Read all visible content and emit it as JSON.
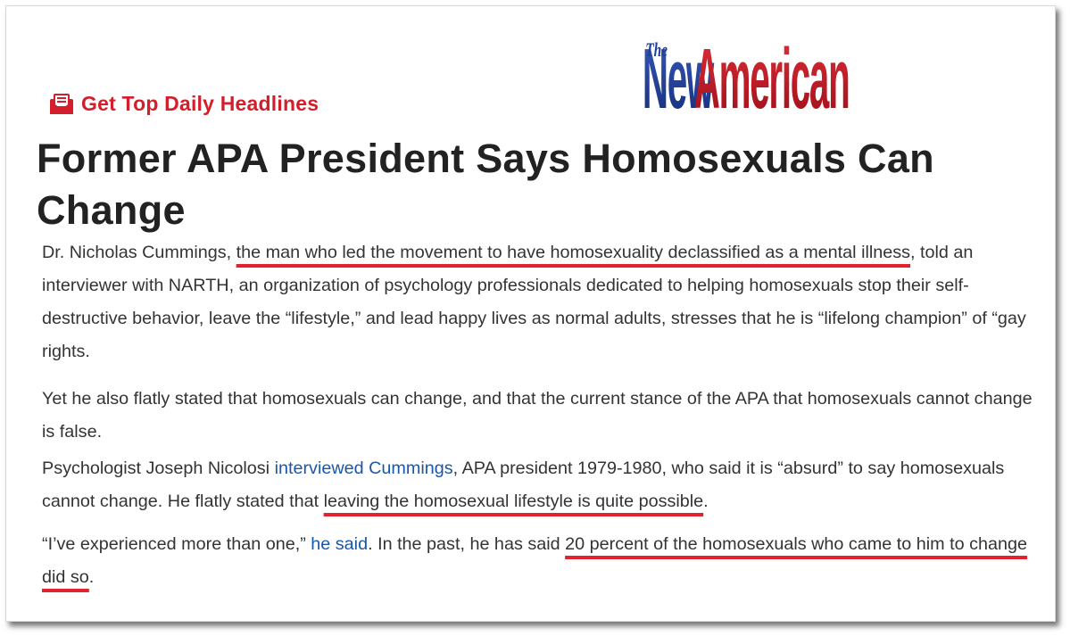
{
  "banner": {
    "label": "Get Top Daily Headlines"
  },
  "logo": {
    "the": "The",
    "name": "New American",
    "color_blue": "#1d3f97",
    "color_red": "#c1121f"
  },
  "article": {
    "title": "Former APA President Says Homosexuals Can Change",
    "p1": {
      "a": "Dr. Nicholas Cummings, ",
      "hl": "the man who led the movement to have homosexuality declassified as a mental illness",
      "b": ", told an interviewer with NARTH, an organization of psychology professionals dedicated to helping homosexuals stop their self-destructive behavior, leave the “lifestyle,” and lead happy lives as normal adults, stresses that he is “lifelong champion” of “gay rights."
    },
    "p2": {
      "text": "Yet he also flatly stated that homosexuals can change, and that the current stance of the APA that homosexuals cannot change is false."
    },
    "p3": {
      "a": "Psychologist Joseph Nicolosi ",
      "link": "interviewed Cummings",
      "b": ", APA president 1979-1980, who said it is “absurd” to say homosexuals cannot change. He flatly stated that ",
      "hl": "leaving the homosexual lifestyle is quite possible",
      "c": "."
    },
    "p4": {
      "a": "“I’ve experienced more than one,” ",
      "link": "he said",
      "b": ". In the past, he has said ",
      "hl": "20 percent of the homosexuals who came to him to change did so",
      "c": "."
    }
  },
  "colors": {
    "accent_red": "#d21f2b",
    "underline_red": "#e0232e",
    "link_blue": "#1a57a8"
  }
}
